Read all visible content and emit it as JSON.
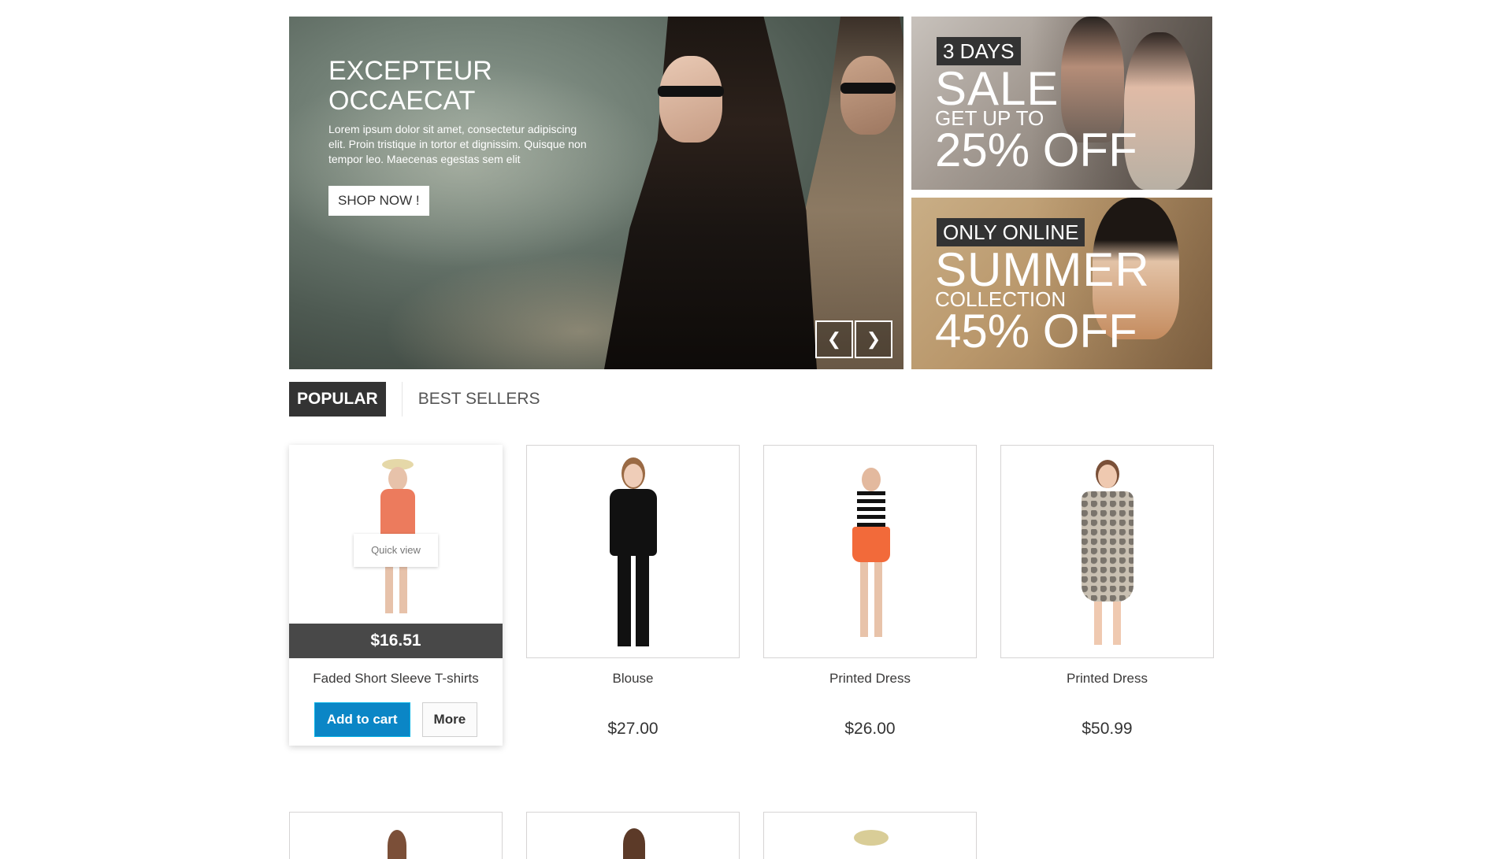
{
  "hero": {
    "title": "EXCEPTEUR OCCAECAT",
    "text": "Lorem ipsum dolor sit amet, consectetur adipiscing elit. Proin tristique in tortor et dignissim. Quisque non tempor leo. Maecenas egestas sem elit",
    "button": "SHOP NOW !",
    "prev_icon": "chevron-left",
    "next_icon": "chevron-right"
  },
  "promos": [
    {
      "tag": "3 DAYS",
      "headline": "SALE",
      "sub": "GET UP TO",
      "discount": "25% OFF"
    },
    {
      "tag": "ONLY ONLINE",
      "headline": "SUMMER",
      "sub": "COLLECTION",
      "discount": "45% OFF"
    }
  ],
  "tabs": [
    "POPULAR",
    "BEST SELLERS"
  ],
  "products": [
    {
      "name": "Faded Short Sleeve T-shirts",
      "price": "$16.51",
      "quick_view": "Quick view",
      "add_to_cart": "Add to cart",
      "more": "More"
    },
    {
      "name": "Blouse",
      "price": "$27.00"
    },
    {
      "name": "Printed Dress",
      "price": "$26.00"
    },
    {
      "name": "Printed Dress",
      "price": "$50.99"
    }
  ],
  "colors": {
    "accent_blue": "#0b86c6",
    "dark": "#333333",
    "price_bar": "#484848"
  }
}
